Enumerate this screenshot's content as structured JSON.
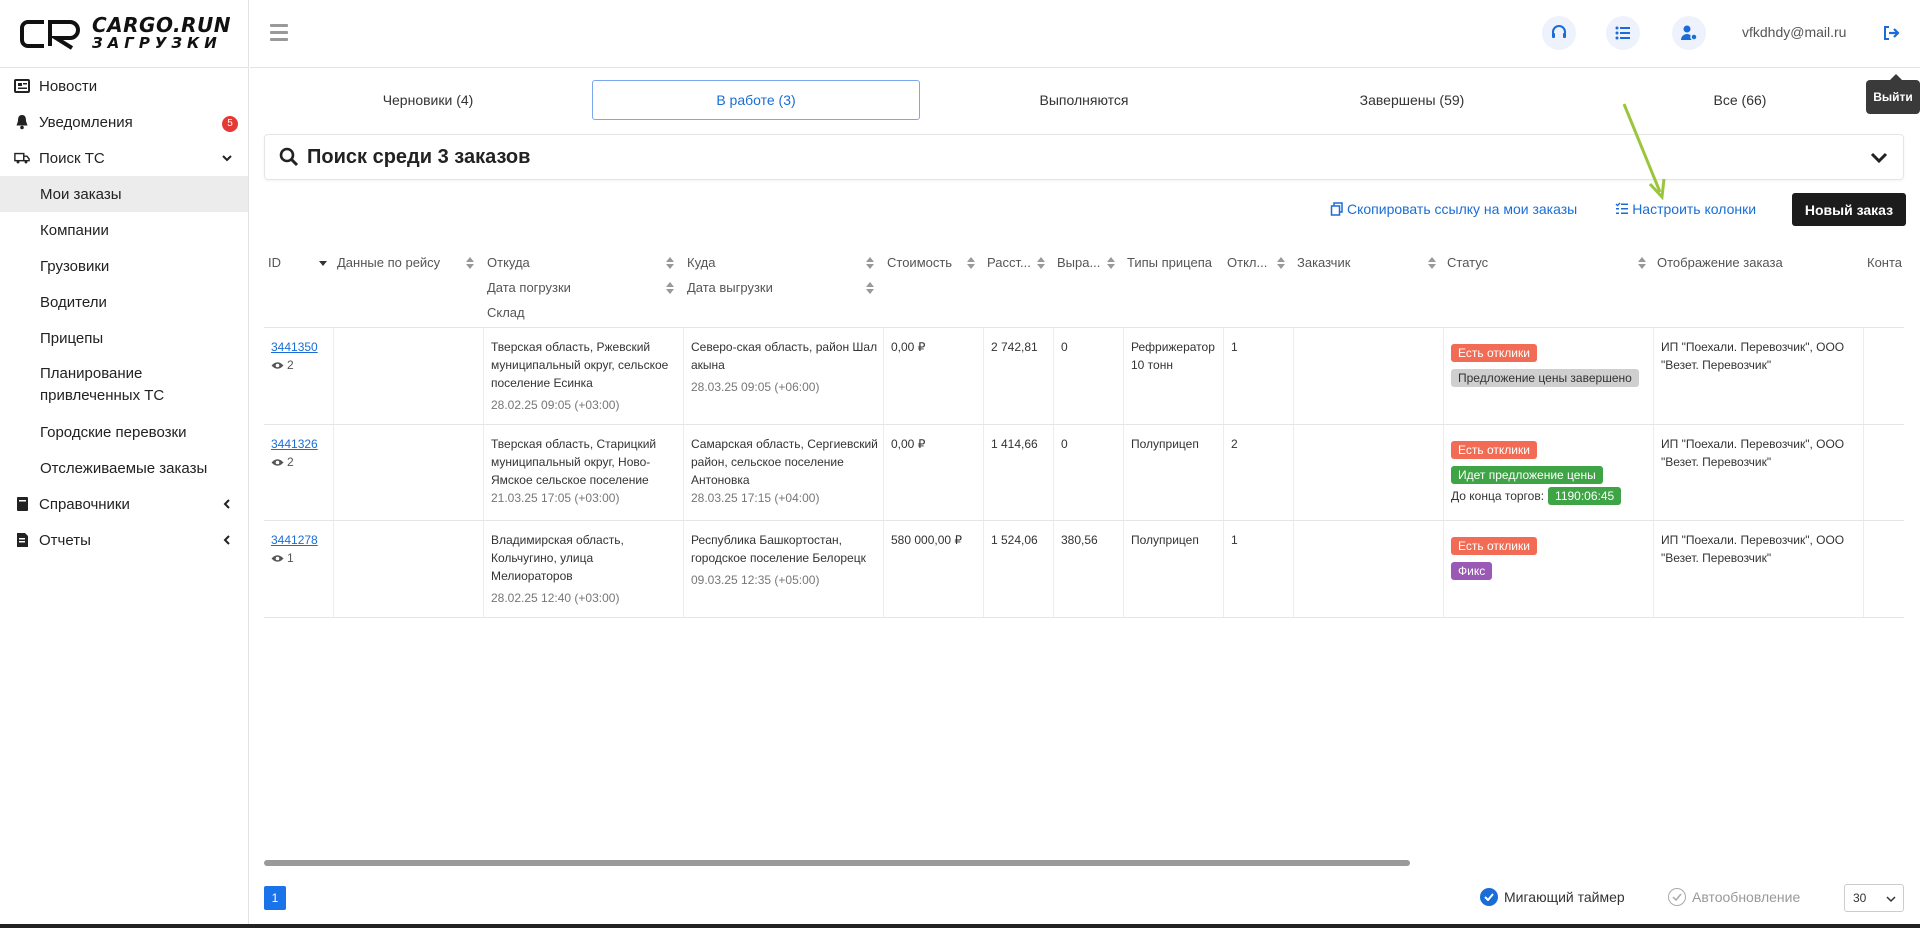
{
  "logo": {
    "line1": "CARGO.RUN",
    "line2": "ЗАГРУЗКИ"
  },
  "sidebar": {
    "items": [
      {
        "label": "Новости",
        "icon": "newspaper-icon"
      },
      {
        "label": "Уведомления",
        "icon": "bell-icon",
        "badge": "5"
      },
      {
        "label": "Поиск ТС",
        "icon": "truck-icon"
      },
      {
        "label": "Мои заказы"
      },
      {
        "label": "Компании"
      },
      {
        "label": "Грузовики"
      },
      {
        "label": "Водители"
      },
      {
        "label": "Прицепы"
      },
      {
        "label": "Планирование привлеченных ТС"
      },
      {
        "label": "Городские перевозки"
      },
      {
        "label": "Отслеживаемые заказы"
      },
      {
        "label": "Справочники",
        "icon": "book-icon"
      },
      {
        "label": "Отчеты",
        "icon": "report-icon"
      }
    ]
  },
  "topbar": {
    "email": "vfkdhdy@mail.ru",
    "logout_tooltip": "Выйти"
  },
  "tabs": [
    {
      "label": "Черновики (4)"
    },
    {
      "label": "В работе (3)"
    },
    {
      "label": "Выполняются"
    },
    {
      "label": "Завершены (59)"
    },
    {
      "label": "Все (66)"
    }
  ],
  "search": {
    "title": "Поиск среди 3 заказов"
  },
  "actions": {
    "copy_link": "Скопировать ссылку на мои заказы",
    "configure_columns": "Настроить колонки",
    "new_order": "Новый заказ"
  },
  "table": {
    "headers": {
      "id": "ID",
      "trip": "Данные по рейсу",
      "from": "Откуда",
      "load_date": "Дата погрузки",
      "warehouse": "Склад",
      "to": "Куда",
      "unload_date": "Дата выгрузки",
      "cost": "Стоимость",
      "distance": "Расст...",
      "revenue": "Выра...",
      "trailer": "Типы прицепа",
      "responses": "Откл...",
      "customer": "Заказчик",
      "status": "Статус",
      "display": "Отображение заказа",
      "contacts": "Конта"
    },
    "rows": [
      {
        "id": "3441350",
        "views": "2",
        "from": "Тверская область, Ржевский муниципальный округ, сельское поселение Есинка",
        "from_date": "28.02.25 09:05 (+03:00)",
        "to": "Северо-ская область, район Шал акына",
        "to_date": "28.03.25 09:05 (+06:00)",
        "cost": "0,00 ₽",
        "distance": "2 742,81",
        "revenue": "0",
        "trailer": "Рефрижератор 10 тонн",
        "responses": "1",
        "tags": [
          "Есть отклики",
          "Предложение цены завершено"
        ],
        "display": "ИП \"Поехали. Перевозчик\", ООО \"Везет. Перевозчик\""
      },
      {
        "id": "3441326",
        "views": "2",
        "from": "Тверская область, Старицкий муниципальный округ, Ново-Ямское сельское поселение",
        "from_date": "21.03.25 17:05 (+03:00)",
        "to": "Самарская область, Сергиевский район, сельское поселение Антоновка",
        "to_date": "28.03.25 17:15 (+04:00)",
        "cost": "0,00 ₽",
        "distance": "1 414,66",
        "revenue": "0",
        "trailer": "Полуприцеп",
        "responses": "2",
        "tags": [
          "Есть отклики",
          "Идет предложение цены"
        ],
        "timer_label": "До конца торгов:",
        "timer": "1190:06:45",
        "display": "ИП \"Поехали. Перевозчик\", ООО \"Везет. Перевозчик\""
      },
      {
        "id": "3441278",
        "views": "1",
        "from": "Владимирская область, Кольчугино, улица Мелиораторов",
        "from_date": "28.02.25 12:40 (+03:00)",
        "to": "Республика Башкортостан, городское поселение Белорецк",
        "to_date": "09.03.25 12:35 (+05:00)",
        "cost": "580 000,00 ₽",
        "distance": "1 524,06",
        "revenue": "380,56",
        "trailer": "Полуприцеп",
        "responses": "1",
        "tags": [
          "Есть отклики",
          "Фикс"
        ],
        "display": "ИП \"Поехали. Перевозчик\", ООО \"Везет. Перевозчик\""
      }
    ]
  },
  "footer": {
    "page": "1",
    "blinking_timer": "Мигающий таймер",
    "auto_update": "Автообновление",
    "page_size": "30"
  },
  "colors": {
    "accent": "#1a6dd6",
    "red_tag": "#f26b55",
    "green_tag": "#3ea446",
    "purple_tag": "#9b59b6",
    "arrow": "#9bc53d"
  }
}
